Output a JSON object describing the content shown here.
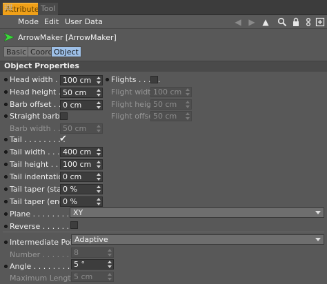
{
  "tabs": [
    "Attributes",
    "Tool"
  ],
  "menu": [
    "Mode",
    "Edit",
    "User Data"
  ],
  "toolbar_icons": [
    "back-arrow-icon",
    "forward-arrow-icon",
    "pointer-up-icon",
    "search-icon",
    "lock-icon",
    "link-icon",
    "new-panel-icon"
  ],
  "object": {
    "name": "ArrowMaker [ArrowMaker]"
  },
  "subtabs": [
    "Basic",
    "Coord.",
    "Object"
  ],
  "section_title": "Object Properties",
  "fields": {
    "head_width": {
      "label": "Head width . .",
      "value": "100 cm"
    },
    "head_height": {
      "label": "Head height . .",
      "value": "50 cm"
    },
    "barb_offset": {
      "label": "Barb offset . .",
      "value": "0 cm"
    },
    "straight_barbs": {
      "label": "Straight barbs"
    },
    "barb_width": {
      "label": "Barb width . .",
      "value": "50 cm"
    },
    "tail": {
      "label": "Tail . . . . . . . . .",
      "check": "✔"
    },
    "tail_width": {
      "label": "Tail width . . . .",
      "value": "400 cm"
    },
    "tail_height": {
      "label": "Tail height . . .",
      "value": "100 cm"
    },
    "tail_indentation": {
      "label": "Tail indentation",
      "value": "0 cm"
    },
    "tail_taper_start": {
      "label": "Tail taper (start)",
      "value": "0 %"
    },
    "tail_taper_end": {
      "label": "Tail taper (end)",
      "value": "0 %"
    },
    "plane": {
      "label": "Plane . . . . . . . . . .",
      "value": "XY"
    },
    "reverse": {
      "label": "Reverse . . . . . . . ."
    },
    "flights": {
      "label": "Flights . . . . ."
    },
    "flight_width": {
      "label": "Flight width",
      "value": "100 cm"
    },
    "flight_height": {
      "label": "Flight height",
      "value": "50 cm"
    },
    "flight_offset": {
      "label": "Flight offset",
      "value": "50 cm"
    },
    "intermediate_points": {
      "label": "Intermediate Points",
      "value": "Adaptive"
    },
    "number": {
      "label": "Number . . . . . . . .",
      "value": "8"
    },
    "angle": {
      "label": "Angle . . . . . . . . . .",
      "value": "5 °"
    },
    "maximum_length": {
      "label": "Maximum Length",
      "value": "5 cm"
    }
  }
}
